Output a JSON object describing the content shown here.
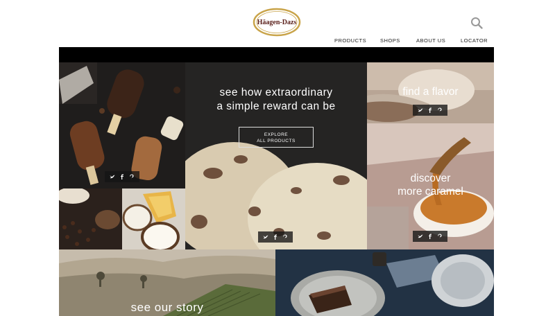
{
  "header": {
    "brand": "Häagen-Dazs",
    "nav": [
      "PRODUCTS",
      "SHOPS",
      "ABOUT US",
      "LOCATOR"
    ]
  },
  "tiles": {
    "hero": {
      "headline_line1": "see how extraordinary",
      "headline_line2": "a simple reward can be",
      "button_line1": "EXPLORE",
      "button_line2": "ALL PRODUCTS"
    },
    "flavor": {
      "title": "find a flavor"
    },
    "caramel": {
      "title_line1": "discover",
      "title_line2": "more caramel"
    },
    "story": {
      "title": "see our story"
    }
  },
  "colors": {
    "brand_gold": "#c9a44a",
    "brand_maroon": "#5a1f1a",
    "share_bg": "#1a1a1a"
  }
}
